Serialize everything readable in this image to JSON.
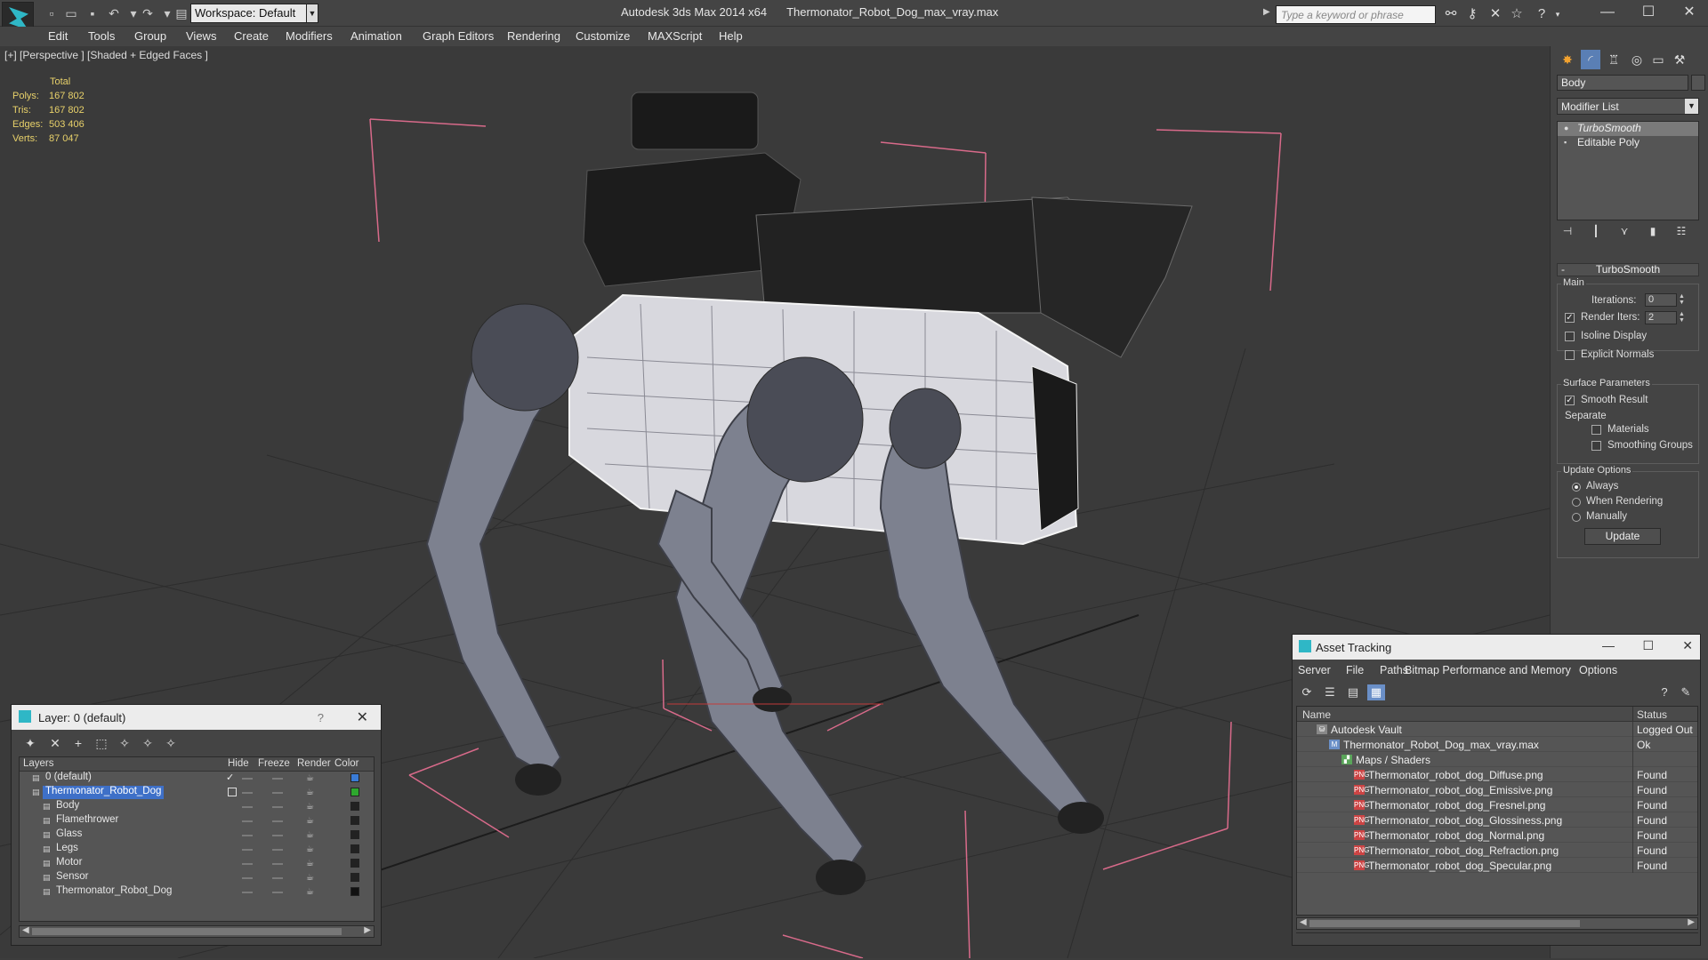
{
  "titlebar": {
    "workspace": "Workspace: Default",
    "app_name": "Autodesk 3ds Max  2014 x64",
    "file_name": "Thermonator_Robot_Dog_max_vray.max",
    "search_placeholder": "Type a keyword or phrase",
    "icons": [
      "new-file-icon",
      "open-file-icon",
      "save-icon",
      "undo-icon",
      "redo-icon",
      "binoculars-icon",
      "key-icon",
      "star-icon",
      "help-icon"
    ]
  },
  "menu": [
    "Edit",
    "Tools",
    "Group",
    "Views",
    "Create",
    "Modifiers",
    "Animation",
    "Graph Editors",
    "Rendering",
    "Customize",
    "MAXScript",
    "Help"
  ],
  "viewport": {
    "label": "[+] [Perspective ] [Shaded + Edged Faces ]",
    "stats": {
      "header": "Total",
      "rows": [
        {
          "k": "Polys:",
          "v": "167 802"
        },
        {
          "k": "Tris:",
          "v": "167 802"
        },
        {
          "k": "Edges:",
          "v": "503 406"
        },
        {
          "k": "Verts:",
          "v": "87 047"
        }
      ]
    }
  },
  "command_panel": {
    "object_name": "Body",
    "modifier_list": "Modifier List",
    "stack": [
      "TurboSmooth",
      "Editable Poly"
    ],
    "rollout": "TurboSmooth",
    "main_group": "Main",
    "iterations_label": "Iterations:",
    "iterations_value": "0",
    "render_iters_label": "Render Iters:",
    "render_iters_value": "2",
    "isoline": "Isoline Display",
    "explicit": "Explicit Normals",
    "surface_group": "Surface Parameters",
    "smooth_result": "Smooth Result",
    "separate": "Separate",
    "materials": "Materials",
    "smoothing_groups": "Smoothing Groups",
    "update_group": "Update Options",
    "always": "Always",
    "when_rendering": "When Rendering",
    "manually": "Manually",
    "update_button": "Update"
  },
  "layer_window": {
    "title": "Layer: 0 (default)",
    "help": "?",
    "columns": [
      "Layers",
      "Hide",
      "Freeze",
      "Render",
      "Color"
    ],
    "rows": [
      {
        "name": "0 (default)",
        "level": 0,
        "color": "#3a7bd5",
        "mark": "check"
      },
      {
        "name": "Thermonator_Robot_Dog",
        "level": 0,
        "color": "#2ea82e",
        "mark": "box",
        "selected": true
      },
      {
        "name": "Body",
        "level": 1,
        "color": "#222222"
      },
      {
        "name": "Flamethrower",
        "level": 1,
        "color": "#222222"
      },
      {
        "name": "Glass",
        "level": 1,
        "color": "#222222"
      },
      {
        "name": "Legs",
        "level": 1,
        "color": "#222222"
      },
      {
        "name": "Motor",
        "level": 1,
        "color": "#222222"
      },
      {
        "name": "Sensor",
        "level": 1,
        "color": "#222222"
      },
      {
        "name": "Thermonator_Robot_Dog",
        "level": 1,
        "color": "#111111"
      }
    ]
  },
  "asset_window": {
    "title": "Asset Tracking",
    "menu": [
      "Server",
      "File",
      "Paths",
      "Bitmap Performance and Memory",
      "Options"
    ],
    "columns": [
      "Name",
      "Status"
    ],
    "rows": [
      {
        "name": "Autodesk Vault",
        "status": "Logged Out",
        "level": 0,
        "icon": "vault"
      },
      {
        "name": "Thermonator_Robot_Dog_max_vray.max",
        "status": "Ok",
        "level": 1,
        "icon": "max"
      },
      {
        "name": "Maps / Shaders",
        "status": "",
        "level": 2,
        "icon": "maps"
      },
      {
        "name": "Thermonator_robot_dog_Diffuse.png",
        "status": "Found",
        "level": 3,
        "icon": "png"
      },
      {
        "name": "Thermonator_robot_dog_Emissive.png",
        "status": "Found",
        "level": 3,
        "icon": "png"
      },
      {
        "name": "Thermonator_robot_dog_Fresnel.png",
        "status": "Found",
        "level": 3,
        "icon": "png"
      },
      {
        "name": "Thermonator_robot_dog_Glossiness.png",
        "status": "Found",
        "level": 3,
        "icon": "png"
      },
      {
        "name": "Thermonator_robot_dog_Normal.png",
        "status": "Found",
        "level": 3,
        "icon": "png"
      },
      {
        "name": "Thermonator_robot_dog_Refraction.png",
        "status": "Found",
        "level": 3,
        "icon": "png"
      },
      {
        "name": "Thermonator_robot_dog_Specular.png",
        "status": "Found",
        "level": 3,
        "icon": "png"
      }
    ]
  },
  "colors": {
    "accent": "#2fb7c6",
    "selection": "#3e70c8",
    "stats": "#e8d16a",
    "bbox": "#d86a8a",
    "wire": "#e6e6e6"
  }
}
